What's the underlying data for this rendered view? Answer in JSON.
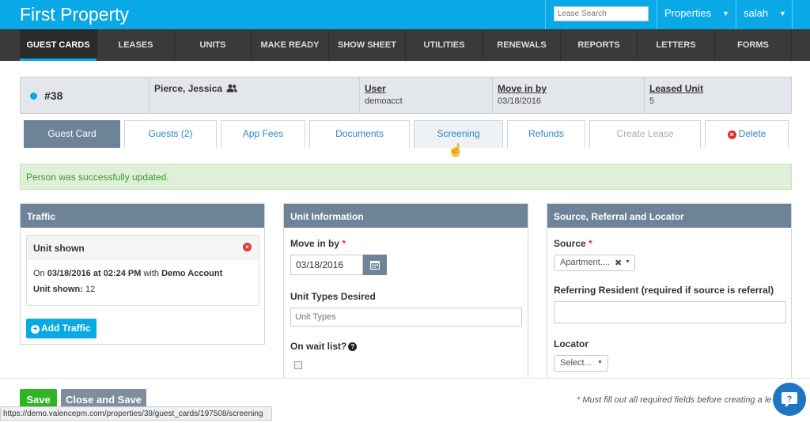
{
  "app": {
    "title": "First Property",
    "search_placeholder": "Lease Search",
    "properties_label": "Properties",
    "user_label": "salah"
  },
  "nav": [
    "GUEST CARDS",
    "LEASES",
    "UNITS",
    "MAKE READY",
    "SHOW SHEET",
    "UTILITIES",
    "RENEWALS",
    "REPORTS",
    "LETTERS",
    "FORMS"
  ],
  "guest_card": {
    "number": "#38",
    "name": "Pierce, Jessica",
    "user_label": "User",
    "user_value": "demoacct",
    "move_in_label": "Move in by",
    "move_in_value": "03/18/2016",
    "leased_unit_label": "Leased Unit",
    "leased_unit_value": "5"
  },
  "tabs": {
    "guest_card": "Guest Card",
    "guests": "Guests (2)",
    "app_fees": "App Fees",
    "documents": "Documents",
    "screening": "Screening",
    "refunds": "Refunds",
    "create_lease": "Create Lease",
    "delete": "Delete"
  },
  "alert": "Person was successfully updated.",
  "traffic": {
    "title": "Traffic",
    "entry_title": "Unit shown",
    "line1_prefix": "On",
    "line1_datetime": "03/18/2016 at 02:24 PM",
    "line1_mid": "with",
    "line1_agent": "Demo Account",
    "line2_label": "Unit shown:",
    "line2_value": "12",
    "add_button": "Add Traffic"
  },
  "unit_info": {
    "title": "Unit Information",
    "move_in_label": "Move in by",
    "move_in_value": "03/18/2016",
    "unit_types_label": "Unit Types Desired",
    "unit_types_placeholder": "Unit Types",
    "wait_list_label": "On wait list?"
  },
  "source_panel": {
    "title": "Source, Referral and Locator",
    "source_label": "Source",
    "source_value": "Apartment....",
    "referring_label": "Referring Resident (required if source is referral)",
    "locator_label": "Locator",
    "locator_value": "Select..."
  },
  "footer": {
    "save": "Save",
    "close_save": "Close and Save",
    "note": "Must fill out all required fields before creating a le",
    "status_url": "https://demo.valencepm.com/properties/39/guest_cards/197508/screening"
  },
  "colors": {
    "brand": "#08a9e6",
    "nav_bg": "#3a3a3a",
    "panel_head": "#6e8398",
    "success_bg": "#dff0d8",
    "save_green": "#2fb327"
  }
}
